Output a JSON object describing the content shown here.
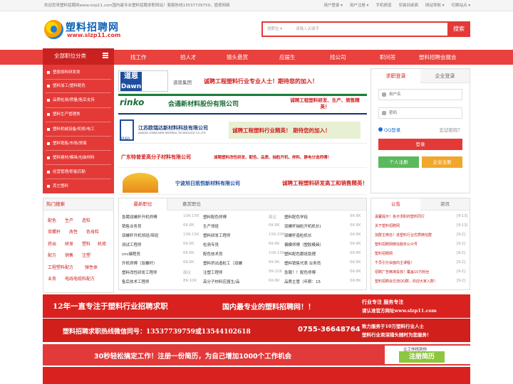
{
  "topbar": {
    "welcome": "欢迎您来塑料招聘网www.slzp11.com国内最专业塑料招聘求职网站！客服热线13537739759，值夜网络",
    "links": [
      "用户登录 ▾",
      "用户注册 ▾",
      "手机频道",
      "安装到桌面",
      "网站导航 ▾",
      "切换站点 ▾"
    ]
  },
  "logo": {
    "name": "塑料招聘网",
    "domain": "www.slzp11.com"
  },
  "search": {
    "select_label": "找职位 ▾",
    "placeholder": "请输入关键字",
    "button": "搜索"
  },
  "nav": {
    "category_button": "全部职位分类",
    "items": [
      "找工作",
      "招人才",
      "猎头悬赏",
      "应届生",
      "找公司",
      "职场资讯",
      "职问答",
      "塑料招聘会展会"
    ]
  },
  "sidebar": {
    "items": [
      "塑胶原料研发类",
      "塑料加工/塑料配色",
      "品质检测/质量/售后支持",
      "塑料生产管理类",
      "塑料机械设备/机修/电工",
      "塑料销售/市场/贸易",
      "塑料建材/模具/包装材料",
      "经营管理/职能后勤",
      "其它塑料"
    ]
  },
  "ads": [
    {
      "company": "道恩集团",
      "logo": "道恩",
      "logo2": "Dawn",
      "slogan": "诚聘工程塑料行业专业人士！期待您的加入！"
    },
    {
      "company": "会通新材料股份有限公司",
      "logo": "rinko",
      "slogan": "诚聘工程塑料研发、生产、销售精英！"
    },
    {
      "company": "江苏欧瑞达新材料科技有限公司",
      "sub": "JIANGSU ORIDA NEW MATERIAL TECHNOLOGY CO.,LTD",
      "logo": "ORiDA",
      "slogan": "诚聘工程塑料行业精英！ 期待您的加入！"
    },
    {
      "company": "广东特普爱高分子材料有限公司",
      "slogan": "诚聘塑料改性研发、配色、品质、抽粒开机、样料、静电分选师傅！"
    },
    {
      "company": "宁波旭日凯悦新材料有限公司",
      "slogan": "诚聘工程塑料研发高工和销售精英！"
    }
  ],
  "login": {
    "tabs": [
      "求职登录",
      "企业登录"
    ],
    "username_placeholder": "用户名",
    "password_placeholder": "密码",
    "qq_login": "QQ登录",
    "forgot": "忘记密码？",
    "login_button": "登录",
    "personal_register": "个人注册",
    "company_register": "企业注册"
  },
  "hot": {
    "title": "热门搜索",
    "tags": [
      "配色",
      "生产",
      "造粒",
      "双螺杆",
      "改性",
      "色母粒",
      "挤出",
      "研发",
      "塑料",
      "机修",
      "配方",
      "销售",
      "注塑",
      "工程塑料配方",
      "弹性体",
      "业务",
      "电线电缆料配方"
    ]
  },
  "jobs": {
    "tabs": [
      "最新职位",
      "悬赏职位"
    ],
    "rows": [
      [
        "急聘双螺杆开机师傅",
        "10K-15K",
        "塑料配色师傅",
        "面议",
        "塑料配色学徒",
        "8K-8K"
      ],
      [
        "销售业务员",
        "6K-8K",
        "生产领班",
        "6K-8K",
        "双螺杆抽粒开机机长(",
        "6K-8K"
      ],
      [
        "双螺杆开机领班/带班",
        "10K-15K",
        "塑料研发工程师",
        "15K-20K",
        "双螺杆造粒机长",
        "6K-8K"
      ],
      [
        "测试工程师",
        "6K-8K",
        "检测专员",
        "6K-8K",
        "偏模师傅（塑胶模具）",
        "6K-8K"
      ],
      [
        "cnc编程员",
        "6K-8K",
        "配色技术员",
        "10K-15K",
        "塑料配色跟班助理",
        "6K-8K"
      ],
      [
        "开机师傅（双螺杆）",
        "6K-8K",
        "塑料挤出造粒工（双螺",
        "6K-8K",
        "塑料销售代表 业务员",
        "6K-8K"
      ],
      [
        "塑料改性研发工程师",
        "面议",
        "注塑工程师",
        "8K-10K",
        "急聘！！配色师傅",
        "6K-8K"
      ],
      [
        "售后技术工程师",
        "8K-10K",
        "高分子材料应届生/品",
        "6K-8K",
        "品质主管（年薪：15",
        "6K-8K"
      ]
    ]
  },
  "news": {
    "tabs": [
      "公告",
      "资讯"
    ],
    "items": [
      {
        "title": "温馨提示！各示求职的塑料同行",
        "date": "[9-13]"
      },
      {
        "title": "关于塑料招聘网",
        "date": "[9-13]"
      },
      {
        "title": "加群主微信！进塑料行业优质微信群",
        "date": "[9-2]"
      },
      {
        "title": "塑料招聘网微信服务公众号",
        "date": "[9-2]"
      },
      {
        "title": "塑料招聘网",
        "date": "[9-2]"
      },
      {
        "title": "千员引分会面向主课程！",
        "date": "[9-2]"
      },
      {
        "title": "招聘广告精准投放！覆盖10万粉丝",
        "date": "[9-2]"
      },
      {
        "title": "塑料招聘会交流QQ群，欢迎大家入群！",
        "date": "[9-2]"
      }
    ]
  },
  "banners": {
    "a_left": "12年一直专注于塑料行业招聘求职",
    "a_mid": "国内最专业的塑料招聘网！！",
    "a_right1": "行业专注  服务专注",
    "a_right2": "请认准官方网址www.slzp11.com",
    "b_left": "塑料招聘求职热线微信同号：13537739759或13544102618",
    "b_phone": "0755-36648764",
    "b_right1": "致力服务于10万塑料行业人士",
    "b_right2": "塑料行业资深猎头随时为您服务！",
    "c_text": "30秒轻松搞定工作！注册一份简历，为自己增加1000个工作机会",
    "c_pre": "让工作找到你",
    "c_button": "注册简历"
  }
}
